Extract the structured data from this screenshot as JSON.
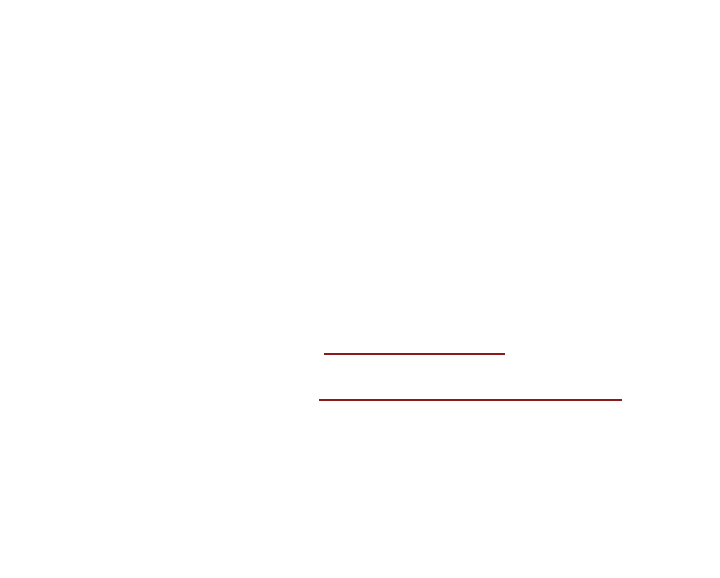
{
  "fields": [
    {
      "value": ""
    },
    {
      "value": ""
    }
  ],
  "colors": {
    "background": "#ffffff",
    "underline": "#8b1a1a"
  }
}
